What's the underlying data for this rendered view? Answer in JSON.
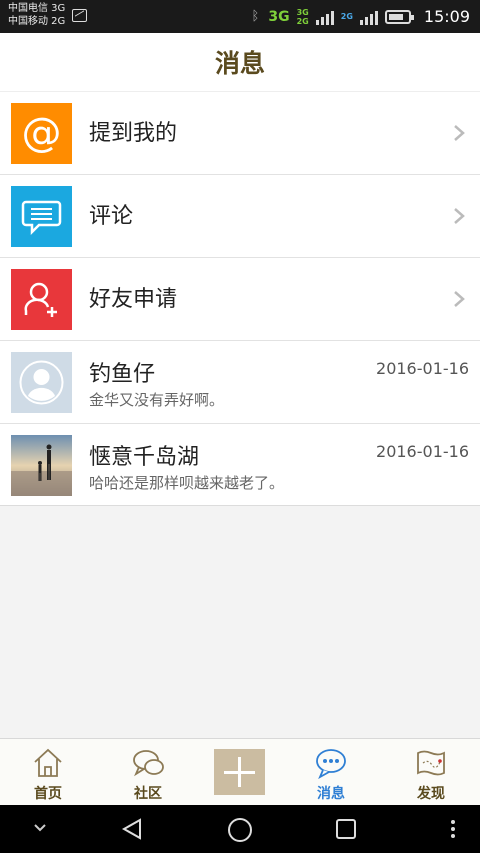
{
  "status_bar": {
    "carrier1": "中国电信 3G",
    "carrier2": "中国移动 2G",
    "net1": "3G",
    "mini_top": "3G",
    "mini_bottom": "2G",
    "net2": "2G",
    "time": "15:09"
  },
  "header": {
    "title": "消息"
  },
  "items": [
    {
      "label": "提到我的",
      "icon": "at-icon",
      "color": "#ff8c00"
    },
    {
      "label": "评论",
      "icon": "comment-icon",
      "color": "#1ba8e0"
    },
    {
      "label": "好友申请",
      "icon": "add-friend-icon",
      "color": "#e8373b"
    }
  ],
  "messages": [
    {
      "name": "钓鱼仔",
      "text": "金华又没有弄好啊。",
      "date": "2016-01-16",
      "avatar": "default-avatar"
    },
    {
      "name": "惬意千岛湖",
      "text": "哈哈还是那样呗越来越老了。",
      "date": "2016-01-16",
      "avatar": "beach-photo-avatar"
    }
  ],
  "tabs": [
    {
      "label": "首页",
      "icon": "home-icon"
    },
    {
      "label": "社区",
      "icon": "community-icon"
    },
    {
      "label": "",
      "icon": "plus-icon"
    },
    {
      "label": "消息",
      "icon": "message-icon",
      "active": true
    },
    {
      "label": "发现",
      "icon": "map-icon"
    }
  ],
  "colors": {
    "accent": "#5a4a1e",
    "active_tab": "#2f7fd4",
    "plus_button": "#cbbca1"
  }
}
